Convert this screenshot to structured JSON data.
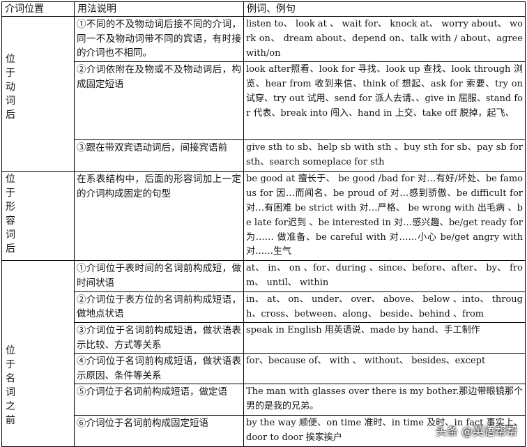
{
  "headers": [
    "介词位置",
    "用法说明",
    "例词、例句"
  ],
  "groups": [
    {
      "position": [
        "位",
        "于",
        "动",
        "词",
        "后"
      ],
      "rows": [
        {
          "usage": "①不同的不及物动词后接不同的介词，同一不及物动词带不同的宾语，有时接的介词也不相同。",
          "examples": "listen to、 look at 、 wait for、 knock at、 worry about、 work on、 dream about、depend on、talk with / about、agree with/on"
        },
        {
          "usage": "②介词依附在及物或不及物动词后，构成固定短语",
          "examples": "look after照看、look for 寻找、look up 查找、look through 浏览、hear from 收到来信、think of 想起、ask for 索要、try on 试穿、try out 试用、send for 派人去请、、give in 屈服、stand for 代表、break into 闯入、hand in 上交、take off 脱掉，起飞、"
        },
        {
          "usage": "③跟在带双宾语动词后，间接宾语前",
          "examples": "give sth to sb、help sb with sth 、buy sth for sb、pay sb for sth、search someplace for sth"
        }
      ]
    },
    {
      "position": [
        "位",
        "于",
        "形",
        "容",
        "词",
        "后"
      ],
      "rows": [
        {
          "usage": "在系表结构中，后面的形容词加上一定的介词构成固定的句型",
          "examples": "be good at 擅长于、 be good /bad for 对…有好/坏处、be famous for 因…而闻名、be proud of 对…感到骄傲、be difficult for 对…有困难 be strict with 对…严格、 be wrong with 出毛病 、be late for迟到 、be interested in 对…感兴趣、be/get ready for 为…… 做准备、be careful with 对……小心 be/get angry with 对……生气"
        }
      ]
    },
    {
      "position": [
        "位",
        "于",
        "名",
        "词",
        "之",
        "前"
      ],
      "rows": [
        {
          "usage": "①介词位于表时间的名词前构成短，做时间状语",
          "examples": "at、 in、 on 、for、during 、since、before、after、 by、 from、 until、 within"
        },
        {
          "usage": "②介词位于表方位的名词前构成短语，做地点状语",
          "examples": "in、 at、 on、 under、 over、 above、 below 、into、 through、cross、between、along、 beside、behind 、from"
        },
        {
          "usage": "③介词位于名词前构成短语，做状语表示比较、方式等关系",
          "examples": "speak in English 用英语说、made by hand、手工制作"
        },
        {
          "usage": "④介词位于名词前构成短语，做状语表示原因、条件等关系",
          "examples": "for、because of、 with 、 without、 besides、except"
        },
        {
          "usage": "⑤介词位于名词前构成短语，做定语",
          "examples": "The man with glasses over there is my bother.那边带眼镜那个男的是我的兄弟。"
        },
        {
          "usage": "⑥介词位于名词前构成固定短语",
          "examples": "by the way 顺便、on time 准时、in time 及时、in fact 事实上、door to door 挨家挨户"
        }
      ]
    }
  ],
  "watermark": "头条 @英语帮帮"
}
